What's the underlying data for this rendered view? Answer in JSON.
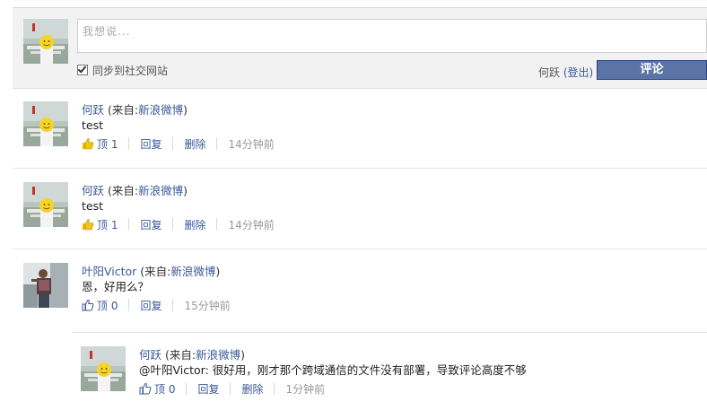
{
  "composer": {
    "placeholder": "我想说...",
    "sync_label": "同步到社交网站",
    "user_name": "何跃",
    "logout_label": "(登出)",
    "submit_label": "评论"
  },
  "comments": [
    {
      "name": "何跃",
      "source_prefix": "(来自:",
      "source_site": "新浪微博",
      "source_suffix": ")",
      "text": "test",
      "like_label": "顶 1",
      "reply_label": "回复",
      "delete_label": "删除",
      "time": "14分钟前"
    },
    {
      "name": "何跃",
      "source_prefix": "(来自:",
      "source_site": "新浪微博",
      "source_suffix": ")",
      "text": "test",
      "like_label": "顶 1",
      "reply_label": "回复",
      "delete_label": "删除",
      "time": "14分钟前"
    },
    {
      "name": "叶阳Victor",
      "source_prefix": "(来自:",
      "source_site": "新浪微博",
      "source_suffix": ")",
      "text": "恩，好用么？",
      "like_label": "顶 0",
      "reply_label": "回复",
      "time": "15分钟前"
    }
  ],
  "reply": {
    "name": "何跃",
    "source_prefix": "(来自:",
    "source_site": "新浪微博",
    "source_suffix": ")",
    "text": "@叶阳Victor: 很好用，刚才那个跨域通信的文件没有部署，导致评论高度不够",
    "like_label": "顶 0",
    "reply_label": "回复",
    "delete_label": "删除",
    "time": "1分钟前"
  },
  "colors": {
    "link": "#3b5998",
    "button": "#5b74a8",
    "liked_thumb": "#e8b400",
    "thumb_outline": "#3b5998"
  }
}
